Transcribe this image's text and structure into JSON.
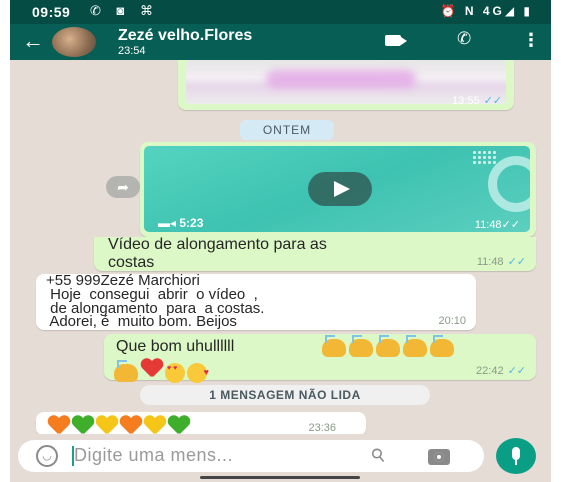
{
  "status_bar": {
    "time": "09:59",
    "left_icons": "✆ ◙ ⌘",
    "right_icons": "⏰ N 4G◢ ▮"
  },
  "header": {
    "contact_name": "Zezé velho.Flores",
    "last_seen": "23:54",
    "icons": [
      "back-arrow-icon",
      "video-call-icon",
      "voice-call-icon",
      "more-options-icon"
    ]
  },
  "chat": {
    "date_divider": "ONTEM",
    "unread_divider": "1 MENSAGEM NÃO LIDA",
    "tick_color": "#4fb6ec",
    "messages": [
      {
        "direction": "out",
        "type": "image",
        "time": "13:55",
        "read": true
      },
      {
        "direction": "out",
        "type": "video",
        "duration": "5:23",
        "time": "11:48",
        "read": true
      },
      {
        "direction": "out",
        "type": "text",
        "text": "Vídeo de alongamento para as\ncostas",
        "time": "11:48",
        "read": true
      },
      {
        "direction": "in",
        "type": "text",
        "text": "+55 999Zezé Marchiori\n Hoje  consegui  abrir  o vídeo  ,\n de alongamento  para  a costas.\n Adorei, é  muito bom. Beijos",
        "time": "20:10"
      },
      {
        "direction": "out",
        "type": "text",
        "text": "Que bom uhullllll",
        "emojis": [
          "clapping-hands",
          "clapping-hands",
          "clapping-hands",
          "clapping-hands",
          "clapping-hands",
          "clapping-hands",
          "red-heart",
          "heart-eyes-face",
          "kissing-face"
        ],
        "time": "22:42",
        "read": true
      },
      {
        "direction": "in",
        "type": "emoji",
        "emojis": [
          "orange-heart",
          "green-heart",
          "yellow-heart",
          "orange-heart",
          "yellow-heart",
          "green-heart"
        ],
        "time": "23:36"
      }
    ]
  },
  "input": {
    "placeholder": "Digite uma mens...",
    "icons": [
      "emoji-icon",
      "attach-icon",
      "camera-icon",
      "microphone-icon"
    ]
  },
  "colors": {
    "header": "#075e54",
    "status_bar": "#054d44",
    "outgoing_bubble": "#dcf8c6",
    "incoming_bubble": "#ffffff",
    "chat_background": "#e5ddd5",
    "mic_button": "#0a9e87"
  }
}
